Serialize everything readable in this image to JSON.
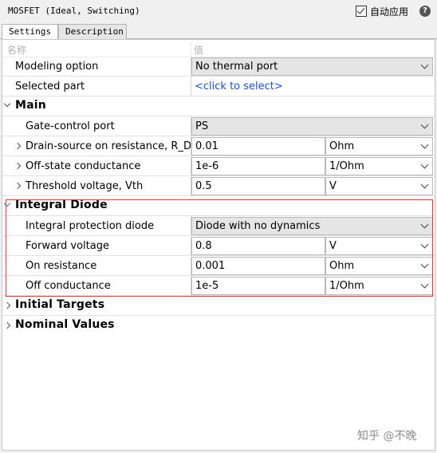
{
  "window": {
    "title": "MOSFET (Ideal, Switching)"
  },
  "auto_apply": {
    "label": "自动应用",
    "checked": true
  },
  "help_icon": "question-circle-icon",
  "tabs": [
    {
      "label": "Settings",
      "active": true
    },
    {
      "label": "Description",
      "active": false
    }
  ],
  "table_header": {
    "name": "名称",
    "value": "值"
  },
  "rows": {
    "modeling_option": {
      "label": "Modeling option",
      "value": "No thermal port"
    },
    "selected_part": {
      "label": "Selected part",
      "value": "<click to select>"
    }
  },
  "sections": {
    "main": {
      "label": "Main",
      "gate_control_port": {
        "label": "Gate-control port",
        "value": "PS"
      },
      "drain_source_resistance": {
        "label": "Drain-source on resistance, R_DS...",
        "value": "0.01",
        "unit": "Ohm"
      },
      "off_state_conductance": {
        "label": "Off-state conductance",
        "value": "1e-6",
        "unit": "1/Ohm"
      },
      "threshold_voltage": {
        "label": "Threshold voltage, Vth",
        "value": "0.5",
        "unit": "V"
      }
    },
    "integral_diode": {
      "label": "Integral Diode",
      "protection_diode": {
        "label": "Integral protection diode",
        "value": "Diode with no dynamics"
      },
      "forward_voltage": {
        "label": "Forward voltage",
        "value": "0.8",
        "unit": "V"
      },
      "on_resistance": {
        "label": "On resistance",
        "value": "0.001",
        "unit": "Ohm"
      },
      "off_conductance": {
        "label": "Off conductance",
        "value": "1e-5",
        "unit": "1/Ohm"
      }
    },
    "initial_targets": {
      "label": "Initial Targets"
    },
    "nominal_values": {
      "label": "Nominal Values"
    }
  },
  "highlight_color": "#e0363a",
  "link_color": "#1a4fd6",
  "watermark": "知乎 @不晚"
}
